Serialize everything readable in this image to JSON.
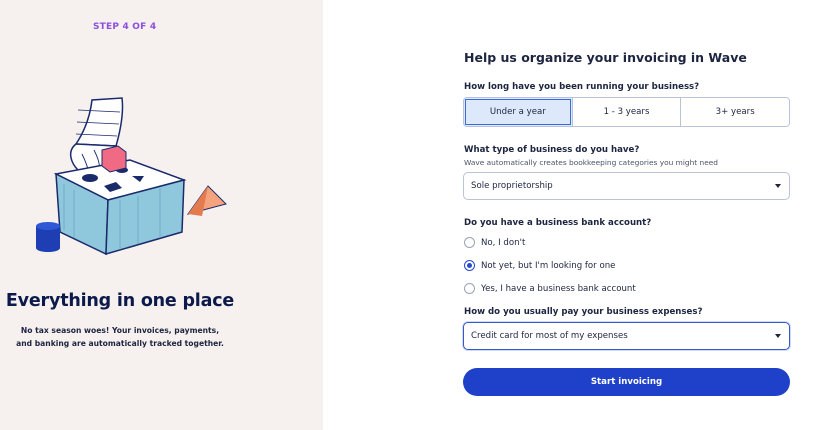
{
  "left": {
    "step_label": "STEP 4 OF 4",
    "hero_title": "Everything in one place",
    "hero_subtitle": "No tax season woes! Your invoices, payments, and banking are automatically tracked together."
  },
  "form": {
    "title": "Help us organize your invoicing in Wave",
    "q1": {
      "label": "How long have you been running your business?",
      "options": [
        "Under a year",
        "1 - 3 years",
        "3+ years"
      ],
      "selected": "Under a year"
    },
    "q2": {
      "label": "What type of business do you have?",
      "help": "Wave automatically creates bookkeeping categories you might need",
      "value": "Sole proprietorship"
    },
    "q3": {
      "label": "Do you have a business bank account?",
      "options": [
        "No, I don't",
        "Not yet, but I'm looking for one",
        "Yes, I have a business bank account"
      ],
      "selected": "Not yet, but I'm looking for one"
    },
    "q4": {
      "label": "How do you usually pay your business expenses?",
      "value": "Credit card for most of my expenses"
    },
    "submit_label": "Start invoicing"
  },
  "colors": {
    "left_bg": "#f6f1ee",
    "step_accent": "#8a4fdc",
    "primary_button": "#1f41c9",
    "selected_segment": "#dde9fb"
  }
}
